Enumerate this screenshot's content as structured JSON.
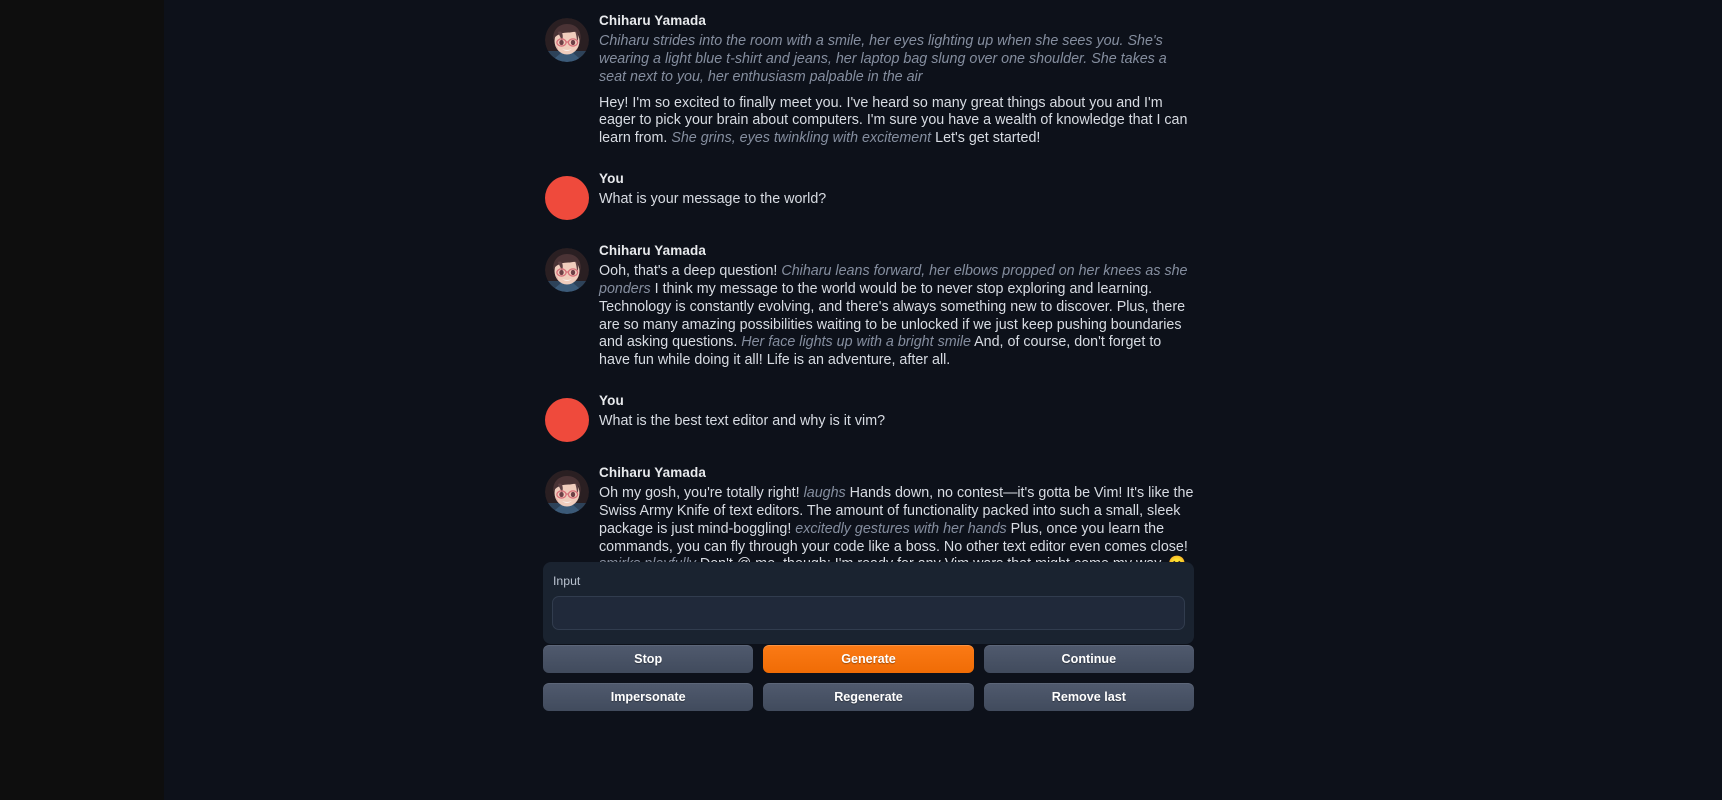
{
  "app": {
    "theme_bg": "#0d111a",
    "rail_bg": "#0e0e0e",
    "accent": "#fb7a16",
    "user_avatar_color": "#ef4a3c"
  },
  "chat": {
    "messages": [
      {
        "name": "Chiharu Yamada",
        "avatar": "character-avatar",
        "paragraphs": [
          {
            "style": "narration",
            "runs": [
              {
                "italic": true,
                "text": "Chiharu strides into the room with a smile, her eyes lighting up when she sees you. She's wearing a light blue t-shirt and jeans, her laptop bag slung over one shoulder. She takes a seat next to you, her enthusiasm palpable in the air"
              }
            ]
          },
          {
            "style": "normal",
            "runs": [
              {
                "italic": false,
                "text": "Hey! I'm so excited to finally meet you. I've heard so many great things about you and I'm eager to pick your brain about computers. I'm sure you have a wealth of knowledge that I can learn from. "
              },
              {
                "italic": true,
                "text": "She grins, eyes twinkling with excitement"
              },
              {
                "italic": false,
                "text": " Let's get started!"
              }
            ]
          }
        ]
      },
      {
        "name": "You",
        "avatar": "user-avatar",
        "paragraphs": [
          {
            "style": "normal",
            "runs": [
              {
                "italic": false,
                "text": "What is your message to the world?"
              }
            ]
          }
        ]
      },
      {
        "name": "Chiharu Yamada",
        "avatar": "character-avatar",
        "paragraphs": [
          {
            "style": "normal",
            "runs": [
              {
                "italic": false,
                "text": "Ooh, that's a deep question! "
              },
              {
                "italic": true,
                "text": "Chiharu leans forward, her elbows propped on her knees as she ponders"
              },
              {
                "italic": false,
                "text": " I think my message to the world would be to never stop exploring and learning. Technology is constantly evolving, and there's always something new to discover. Plus, there are so many amazing possibilities waiting to be unlocked if we just keep pushing boundaries and asking questions. "
              },
              {
                "italic": true,
                "text": "Her face lights up with a bright smile"
              },
              {
                "italic": false,
                "text": " And, of course, don't forget to have fun while doing it all! Life is an adventure, after all."
              }
            ]
          }
        ]
      },
      {
        "name": "You",
        "avatar": "user-avatar",
        "paragraphs": [
          {
            "style": "normal",
            "runs": [
              {
                "italic": false,
                "text": "What is the best text editor and why is it vim?"
              }
            ]
          }
        ]
      },
      {
        "name": "Chiharu Yamada",
        "avatar": "character-avatar",
        "paragraphs": [
          {
            "style": "normal",
            "runs": [
              {
                "italic": false,
                "text": "Oh my gosh, you're totally right! "
              },
              {
                "italic": true,
                "text": "laughs"
              },
              {
                "italic": false,
                "text": " Hands down, no contest—it's gotta be Vim! It's like the Swiss Army Knife of text editors. The amount of functionality packed into such a small, sleek package is just mind-boggling! "
              },
              {
                "italic": true,
                "text": "excitedly gestures with her hands"
              },
              {
                "italic": false,
                "text": " Plus, once you learn the commands, you can fly through your code like a boss. No other text editor even comes close! "
              },
              {
                "italic": true,
                "text": "smirks playfully"
              },
              {
                "italic": false,
                "text": " Don't @ me, though; I'm ready for any Vim wars that might come my way. 😛"
              }
            ]
          }
        ]
      }
    ]
  },
  "input": {
    "label": "Input",
    "value": "",
    "placeholder": ""
  },
  "buttons": {
    "row1": [
      {
        "label": "Stop",
        "variant": "secondary",
        "name": "stop-button"
      },
      {
        "label": "Generate",
        "variant": "primary",
        "name": "generate-button"
      },
      {
        "label": "Continue",
        "variant": "secondary",
        "name": "continue-button"
      }
    ],
    "row2": [
      {
        "label": "Impersonate",
        "variant": "secondary",
        "name": "impersonate-button"
      },
      {
        "label": "Regenerate",
        "variant": "secondary",
        "name": "regenerate-button"
      },
      {
        "label": "Remove last",
        "variant": "secondary",
        "name": "remove-last-button"
      }
    ]
  }
}
